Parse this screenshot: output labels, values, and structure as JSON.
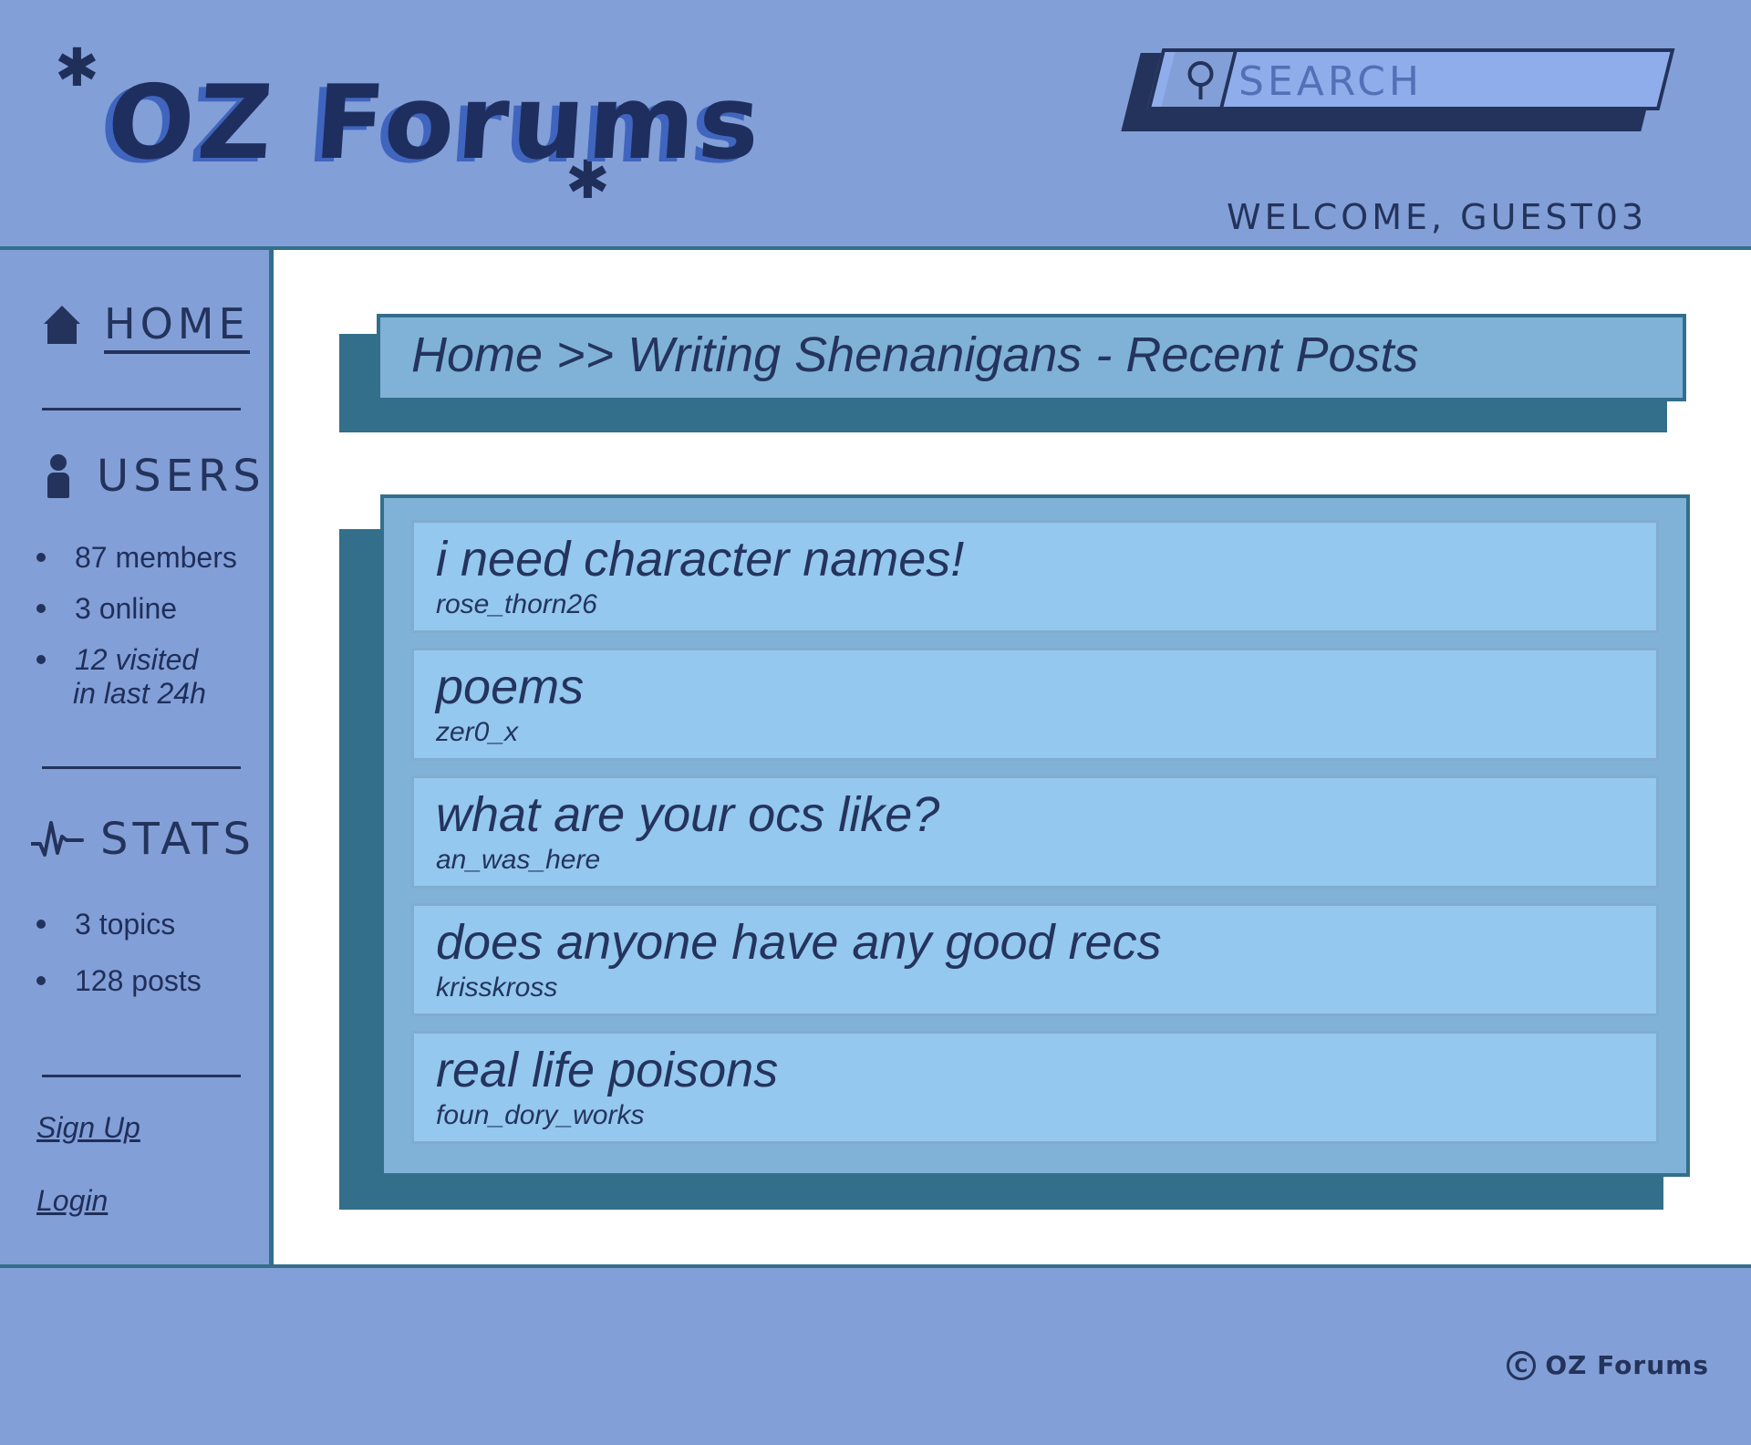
{
  "header": {
    "logo": "OZ Forums",
    "search_placeholder": "SEARCH",
    "welcome": "WELCOME, GUEST03"
  },
  "sidebar": {
    "home_label": "HOME",
    "users_title": "USERS",
    "users_stats": [
      "87 members",
      "3 online",
      "12 visited",
      "in last 24h"
    ],
    "stats_title": "STATS",
    "stats": [
      "3 topics",
      "128 posts"
    ],
    "signup_label": "Sign Up",
    "login_label": "Login"
  },
  "main": {
    "breadcrumb": "Home >> Writing Shenanigans - Recent Posts",
    "posts": [
      {
        "title": "i need character names!",
        "author": "rose_thorn26"
      },
      {
        "title": "poems",
        "author": "zer0_x"
      },
      {
        "title": "what are your ocs like?",
        "author": "an_was_here"
      },
      {
        "title": "does anyone have any good recs",
        "author": "krisskross"
      },
      {
        "title": "real life poisons",
        "author": "foun_dory_works"
      }
    ]
  },
  "footer": {
    "copyright_symbol": "C",
    "copyright_text": "OZ Forums"
  },
  "icons": [
    "star-icon",
    "search-icon",
    "home-icon",
    "user-icon",
    "pulse-icon",
    "copyright-icon"
  ],
  "colors": {
    "background": "#839fd7",
    "dark": "#23335b",
    "teal": "#336f8b",
    "panel": "#80b2d7",
    "post": "#94c8ee"
  }
}
